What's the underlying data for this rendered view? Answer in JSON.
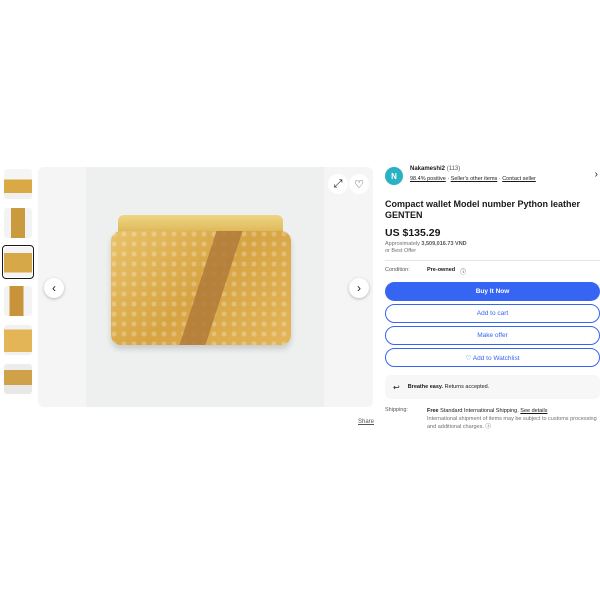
{
  "gallery": {
    "thumbnails": [
      "thumb-1",
      "thumb-2",
      "thumb-3",
      "thumb-4",
      "thumb-5",
      "thumb-6"
    ],
    "selected_index": 2,
    "share_label": "Share"
  },
  "seller": {
    "initial": "N",
    "name": "Nakameshi2",
    "feedback_count": "(113)",
    "positive": "98.4% positive",
    "separator": "·",
    "other_items": "Seller's other items",
    "contact": "Contact seller"
  },
  "listing": {
    "title": "Compact wallet Model number Python leather GENTEN",
    "price": "US $135.29",
    "approx_prefix": "Approximately",
    "approx_value": "3,509,016.73 VND",
    "offer": "or Best Offer",
    "condition_label": "Condition:",
    "condition_value": "Pre-owned"
  },
  "actions": {
    "buy_now": "Buy It Now",
    "add_to_cart": "Add to cart",
    "make_offer": "Make offer",
    "watchlist": "♡ Add to Watchlist"
  },
  "notice": {
    "bold": "Breathe easy.",
    "text": " Returns accepted."
  },
  "shipping": {
    "label": "Shipping:",
    "free": "Free",
    "method": " Standard International Shipping.",
    "details": "See details",
    "note": "International shipment of items may be subject to customs processing and additional charges."
  },
  "colors": {
    "accent": "#3665f3",
    "avatar": "#2bb0c4"
  }
}
